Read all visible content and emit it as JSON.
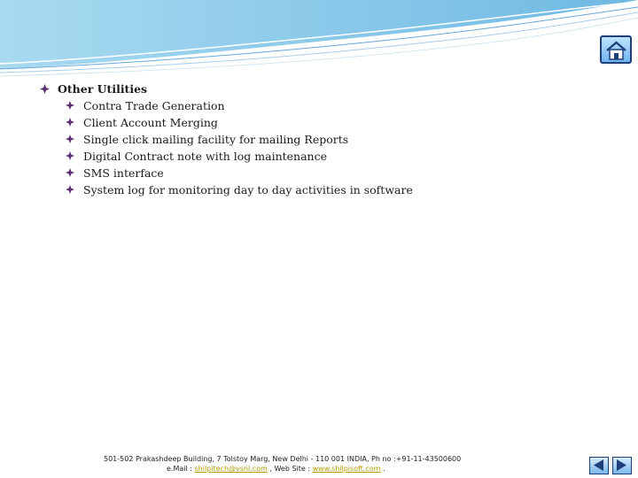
{
  "section": {
    "title": "Other Utilities",
    "items": [
      "Contra Trade Generation",
      "Client Account Merging",
      "Single click mailing facility for mailing Reports",
      "Digital Contract note with log maintenance",
      "SMS interface",
      "System log for monitoring day  to day  activities in software"
    ]
  },
  "footer": {
    "address": "501-502 Prakashdeep Building, 7 Tolstoy Marg, New Delhi - 110 001 INDIA,  Ph no :+91-11-43500600",
    "email_label": "e.Mail : ",
    "email": "shilpitech@vsnl.com",
    "web_label": " , Web Site : ",
    "website": "www.shilpisoft.com",
    "end": " ."
  },
  "colors": {
    "bullet": "#5a2d6e",
    "header_wave": "#7fc3e6",
    "nav_border": "#1f3f7a"
  },
  "icons": [
    "home-icon",
    "prev-arrow-icon",
    "next-arrow-icon",
    "diamond-bullet-icon"
  ]
}
